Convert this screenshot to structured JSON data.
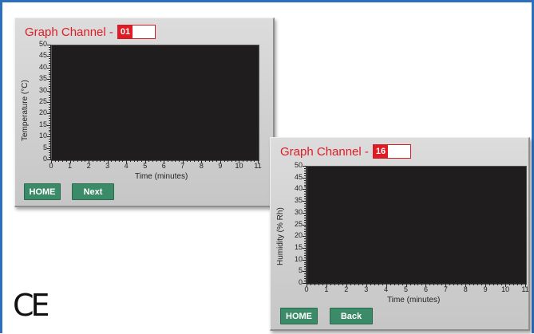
{
  "panel1": {
    "title": "Graph Channel -",
    "channel": "01",
    "ylabel": "Temperature (°C)",
    "xlabel": "Time (minutes)",
    "y_ticks": [
      "0",
      "5",
      "10",
      "15",
      "20",
      "25",
      "30",
      "35",
      "40",
      "45",
      "50"
    ],
    "x_ticks": [
      "0",
      "1",
      "2",
      "3",
      "4",
      "5",
      "6",
      "7",
      "8",
      "9",
      "10",
      "11"
    ],
    "buttons": {
      "home": "HOME",
      "next": "Next"
    }
  },
  "panel2": {
    "title": "Graph Channel -",
    "channel": "16",
    "ylabel": "Humidity (% Rh)",
    "xlabel": "Time (minutes)",
    "y_ticks": [
      "0",
      "5",
      "10",
      "15",
      "20",
      "25",
      "30",
      "35",
      "40",
      "45",
      "50"
    ],
    "x_ticks": [
      "0",
      "1",
      "2",
      "3",
      "4",
      "5",
      "6",
      "7",
      "8",
      "9",
      "10",
      "11"
    ],
    "buttons": {
      "home": "HOME",
      "back": "Back"
    }
  },
  "ce_mark": "CE",
  "colors": {
    "frame": "#2e6fbd",
    "title": "#e01b24",
    "plot_bg": "#1f1d1d",
    "button": "#3b8a68"
  }
}
